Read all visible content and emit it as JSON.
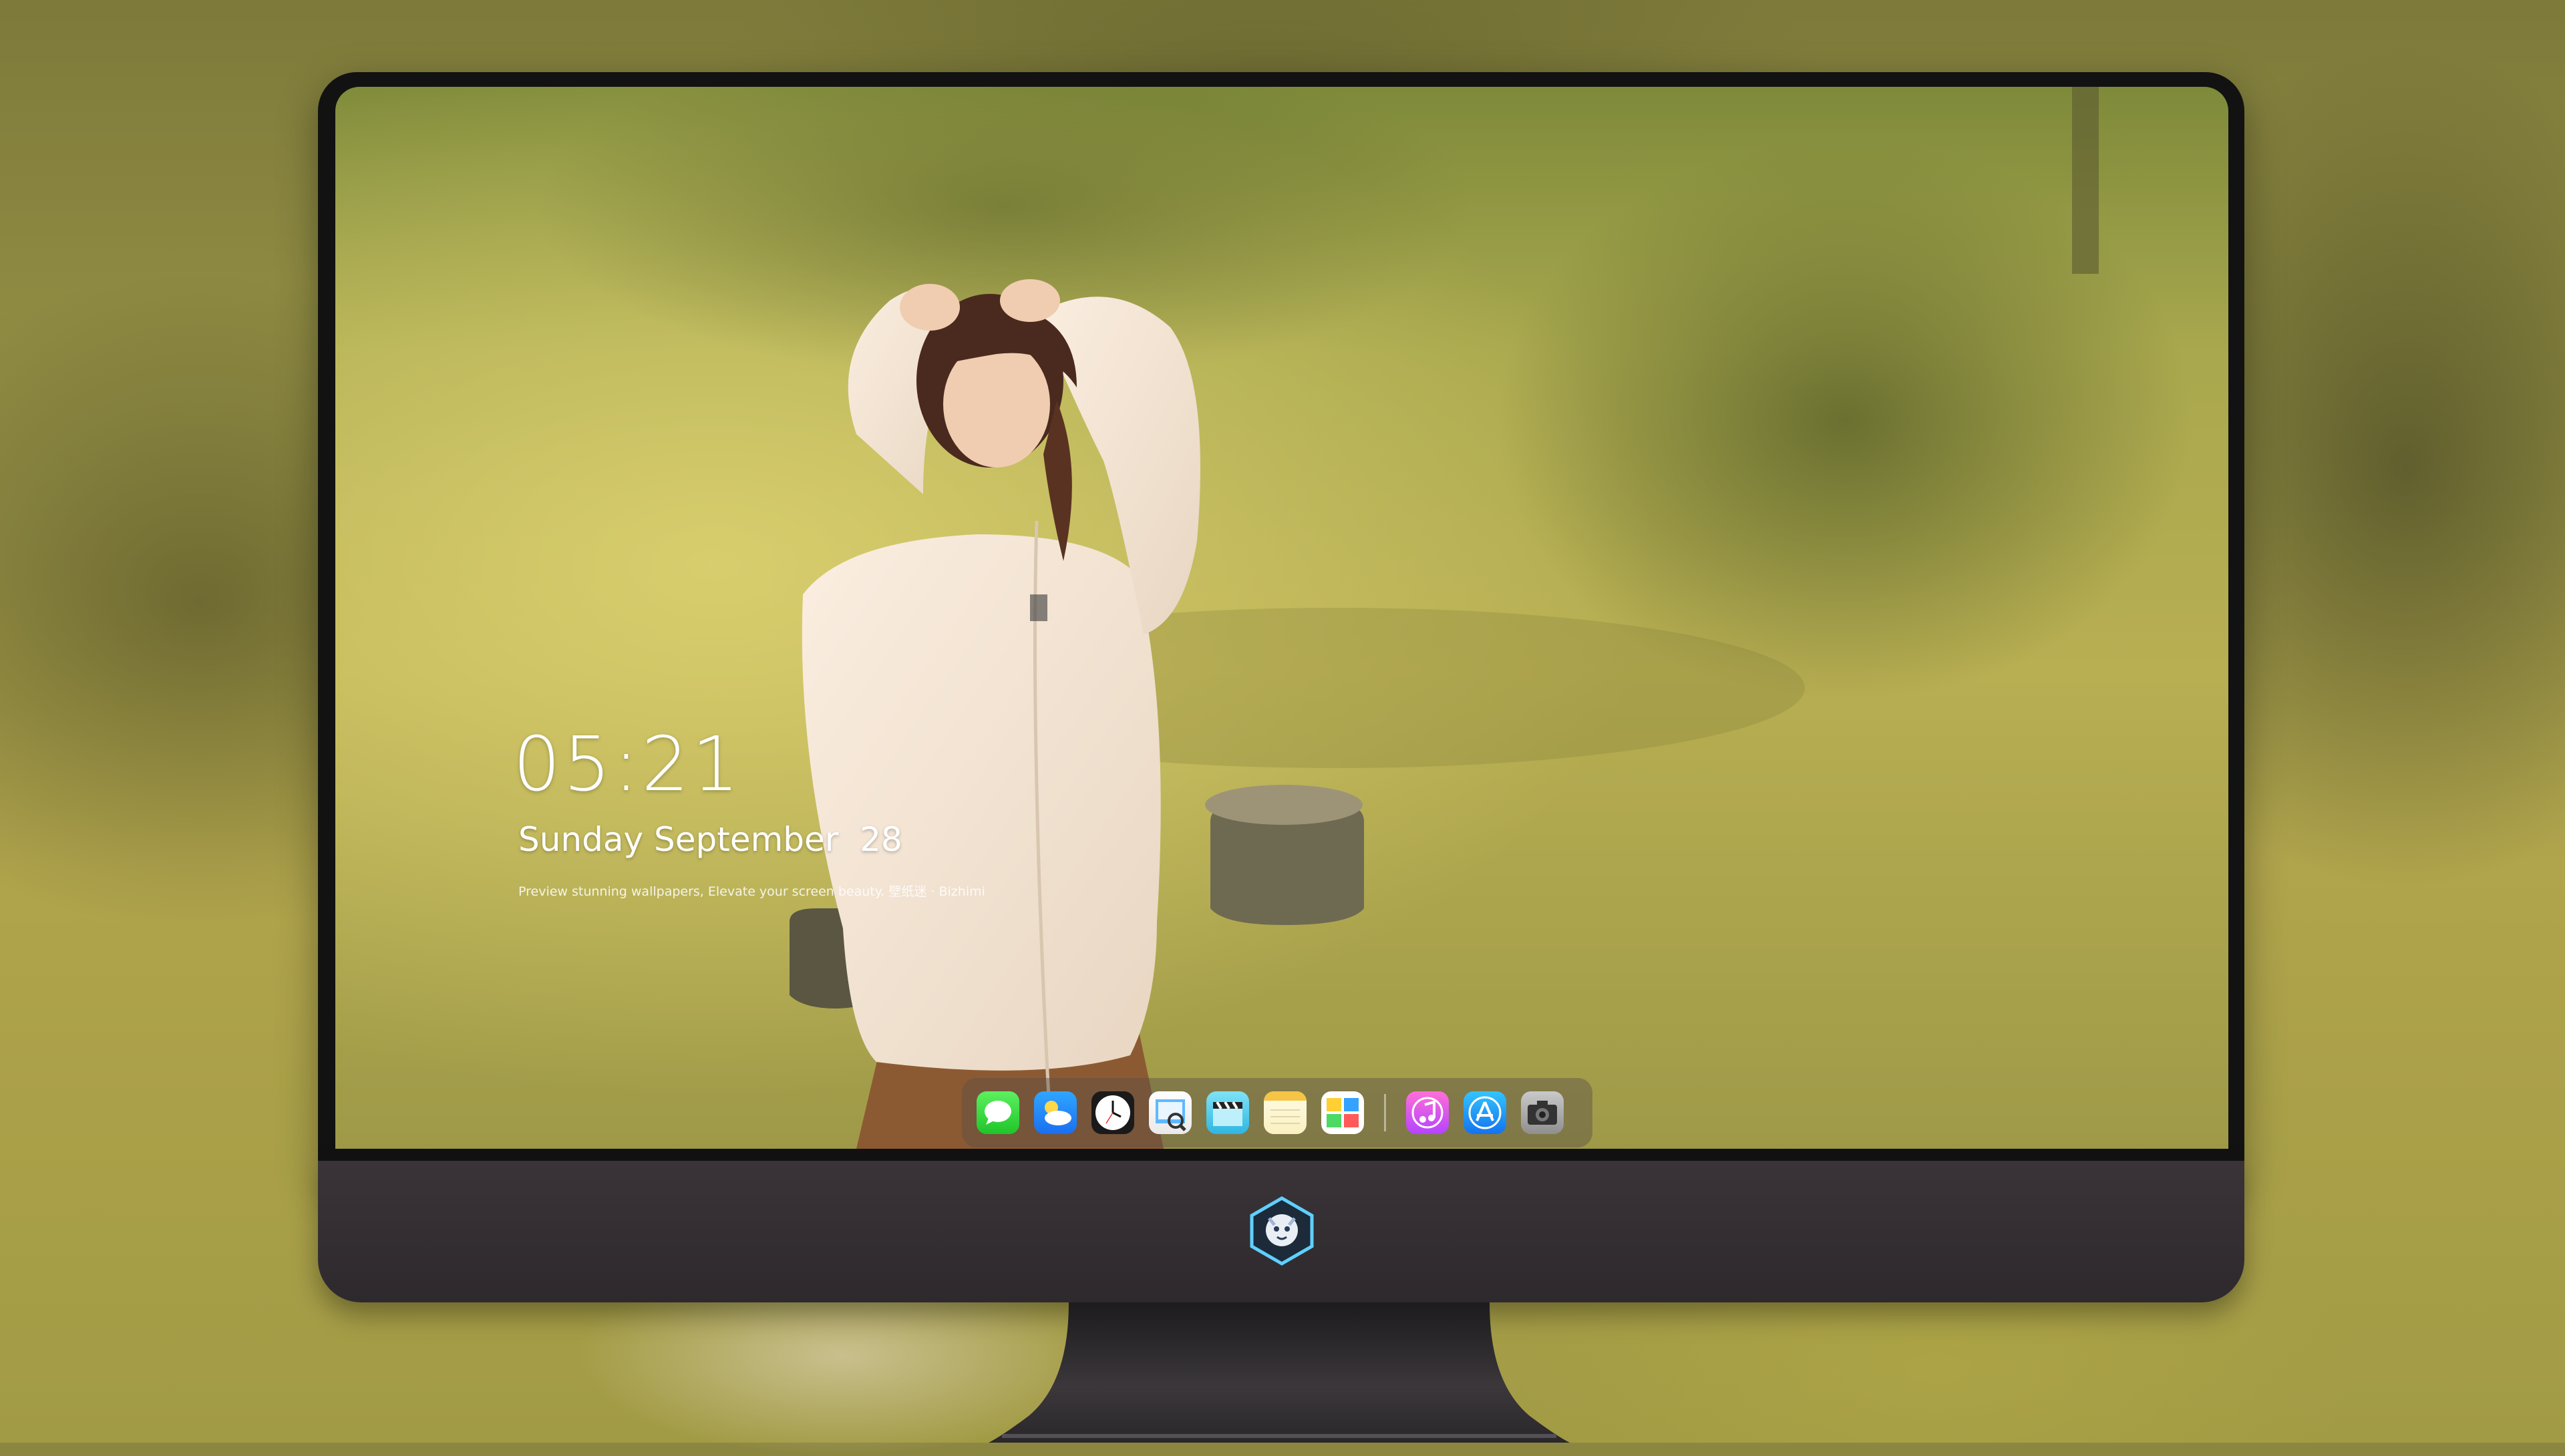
{
  "lock_screen": {
    "time": "05:21",
    "date": "Sunday September  28",
    "tagline": "Preview stunning wallpapers, Elevate your screen beauty. 壁纸迷 · Bizhimi"
  },
  "dock": {
    "apps": [
      {
        "icon": "messages-icon"
      },
      {
        "icon": "weather-icon"
      },
      {
        "icon": "clock-icon"
      },
      {
        "icon": "preview-icon"
      },
      {
        "icon": "video-clapper-icon"
      },
      {
        "icon": "notes-icon"
      },
      {
        "icon": "photos-icon"
      },
      {
        "icon": "music-icon"
      },
      {
        "icon": "app-store-icon"
      },
      {
        "icon": "camera-icon"
      }
    ]
  },
  "colors": {
    "bezel": "#121212",
    "chin": "#3a3438",
    "text": "#ffffff"
  }
}
